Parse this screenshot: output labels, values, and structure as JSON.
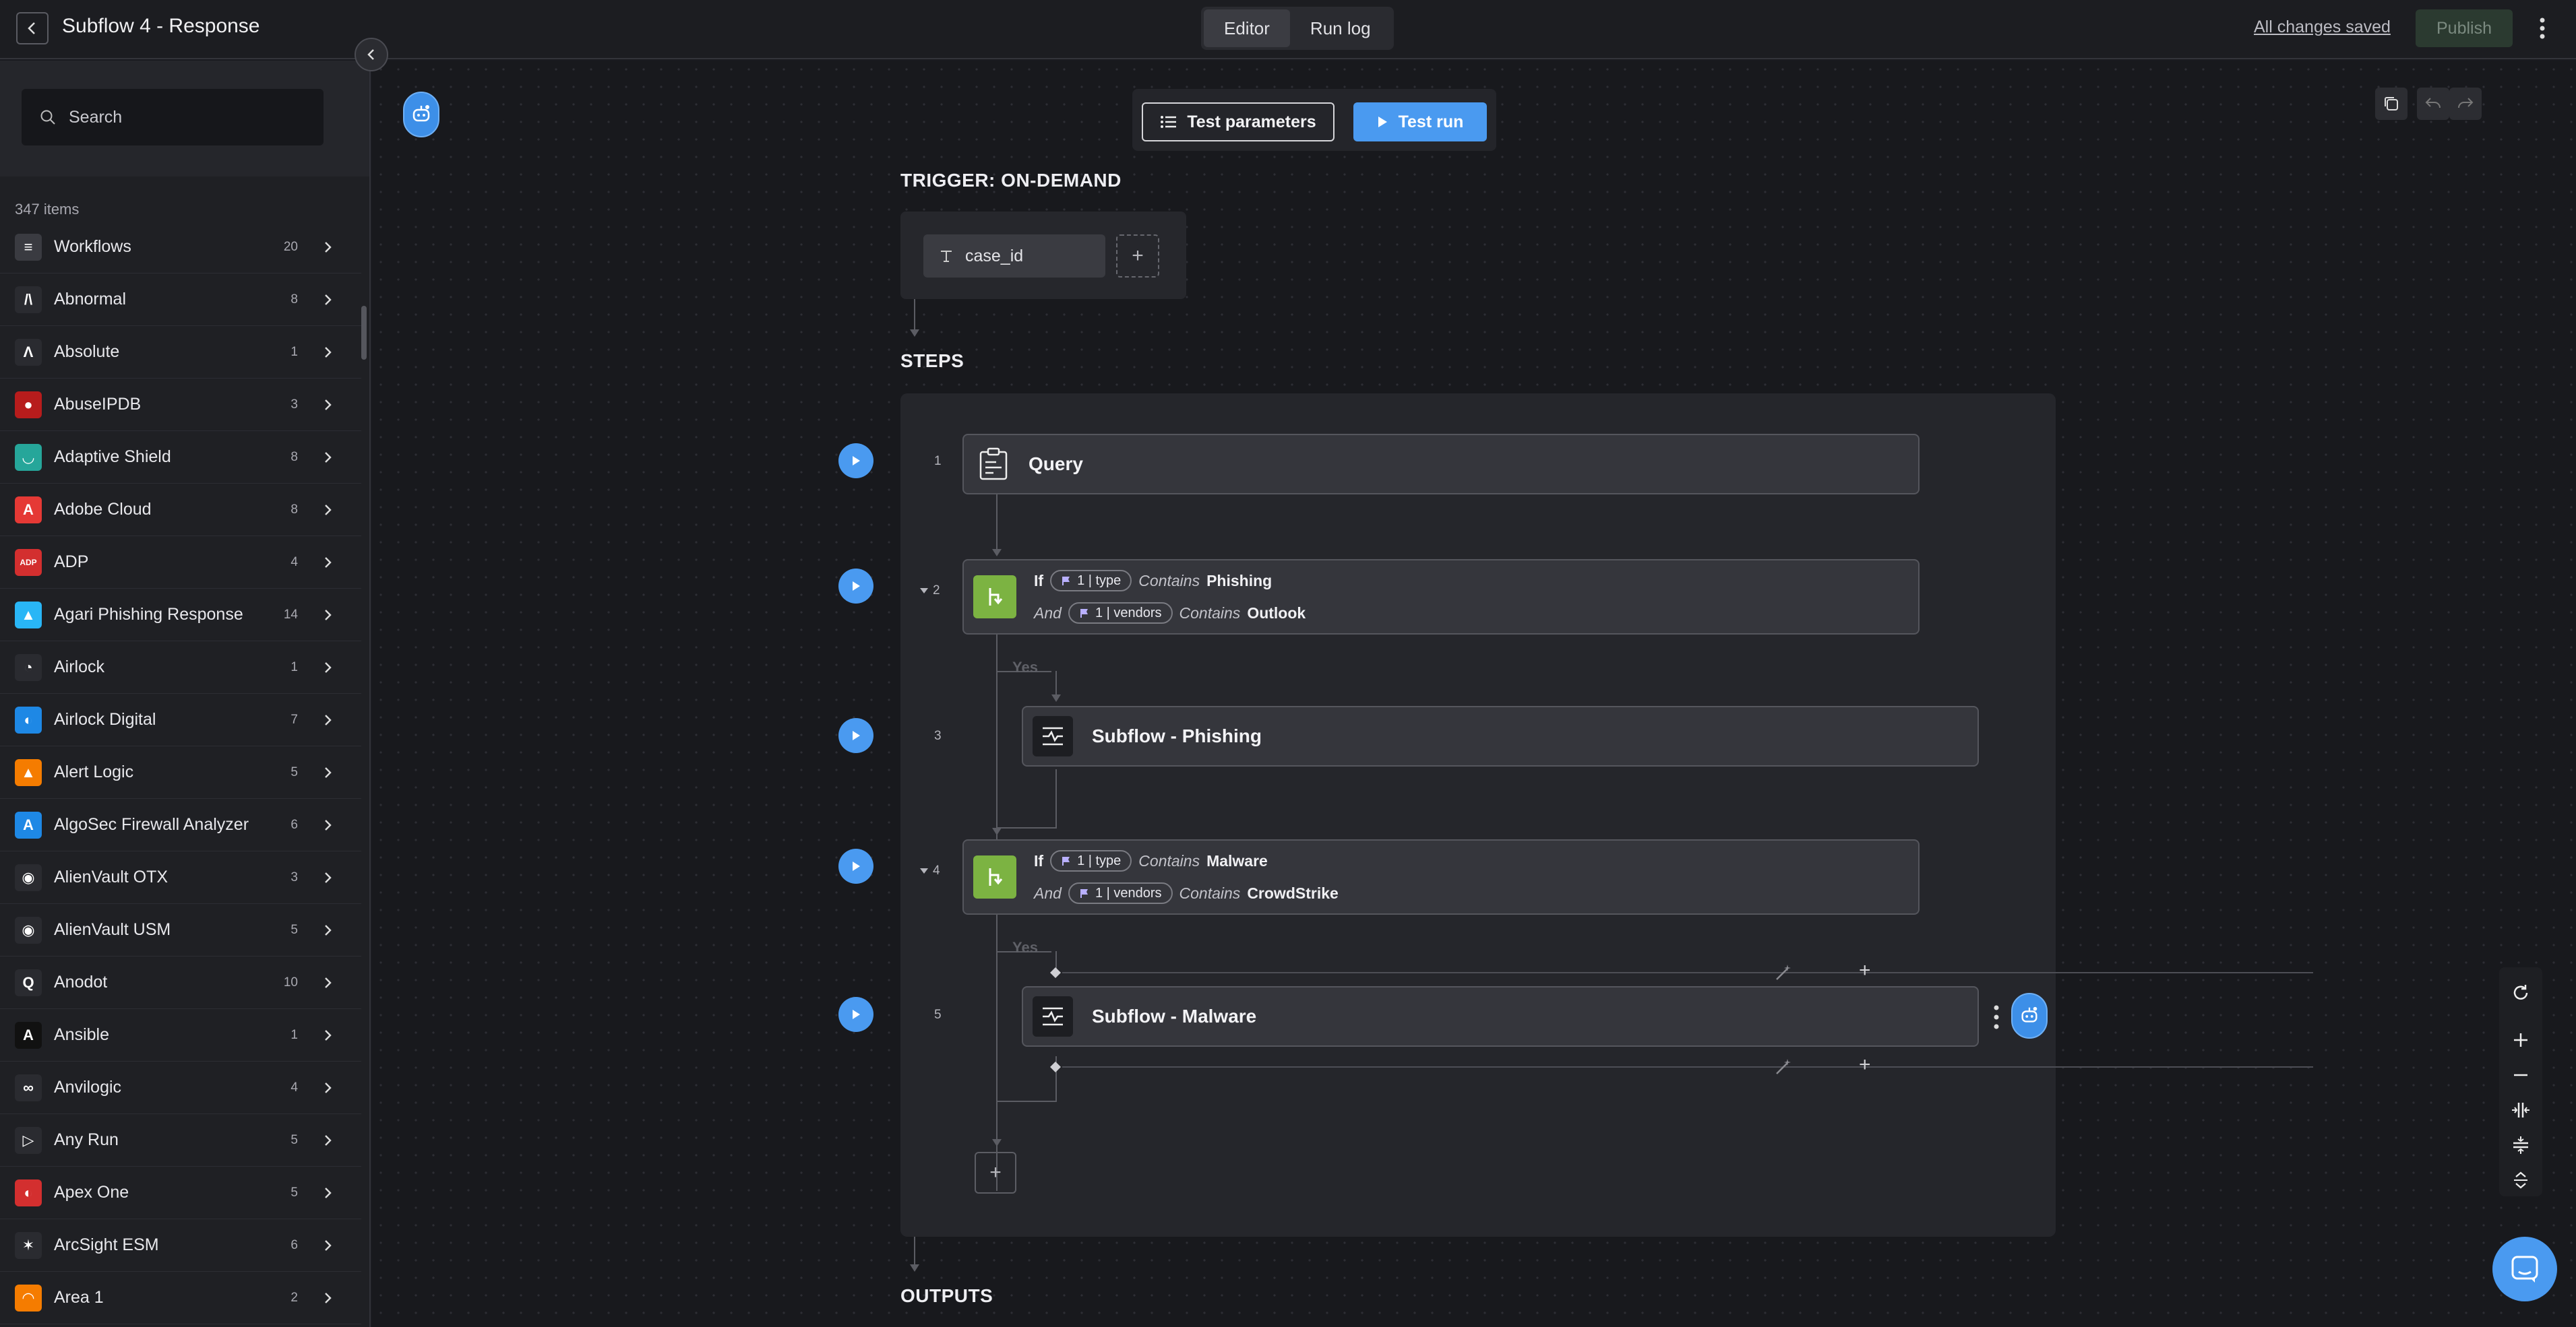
{
  "header": {
    "back_icon": "chevron-left-icon",
    "title": "Subflow 4 - Response",
    "tabs": [
      {
        "label": "Editor",
        "active": true
      },
      {
        "label": "Run log",
        "active": false
      }
    ],
    "saved_status": "All changes saved",
    "publish_label": "Publish"
  },
  "sidebar": {
    "search_placeholder": "Search",
    "item_count": "347 items",
    "items": [
      {
        "label": "Workflows",
        "count": "20",
        "icon": "workflow-icon",
        "color": "#3a3b41"
      },
      {
        "label": "Abnormal",
        "count": "8",
        "icon": "abnormal-logo-icon",
        "color": "#2a2b30"
      },
      {
        "label": "Absolute",
        "count": "1",
        "icon": "absolute-logo-icon",
        "color": "#2a2b30"
      },
      {
        "label": "AbuseIPDB",
        "count": "3",
        "icon": "abuseipdb-logo-icon",
        "color": "#b71c1c"
      },
      {
        "label": "Adaptive Shield",
        "count": "8",
        "icon": "adaptive-shield-logo-icon",
        "color": "#26a69a"
      },
      {
        "label": "Adobe Cloud",
        "count": "8",
        "icon": "adobe-cloud-logo-icon",
        "color": "#e53935"
      },
      {
        "label": "ADP",
        "count": "4",
        "icon": "adp-logo-icon",
        "color": "#d32f2f"
      },
      {
        "label": "Agari Phishing Response",
        "count": "14",
        "icon": "agari-logo-icon",
        "color": "#29b6f6"
      },
      {
        "label": "Airlock",
        "count": "1",
        "icon": "airlock-logo-icon",
        "color": "#2a2b30"
      },
      {
        "label": "Airlock Digital",
        "count": "7",
        "icon": "airlock-digital-logo-icon",
        "color": "#1e88e5"
      },
      {
        "label": "Alert Logic",
        "count": "5",
        "icon": "alert-logic-logo-icon",
        "color": "#f57c00"
      },
      {
        "label": "AlgoSec Firewall Analyzer",
        "count": "6",
        "icon": "algosec-logo-icon",
        "color": "#1e88e5"
      },
      {
        "label": "AlienVault OTX",
        "count": "3",
        "icon": "alienvault-otx-logo-icon",
        "color": "#2a2b30"
      },
      {
        "label": "AlienVault USM",
        "count": "5",
        "icon": "alienvault-usm-logo-icon",
        "color": "#2a2b30"
      },
      {
        "label": "Anodot",
        "count": "10",
        "icon": "anodot-logo-icon",
        "color": "#2a2b30"
      },
      {
        "label": "Ansible",
        "count": "1",
        "icon": "ansible-logo-icon",
        "color": "#111111"
      },
      {
        "label": "Anvilogic",
        "count": "4",
        "icon": "anvilogic-logo-icon",
        "color": "#2a2b30"
      },
      {
        "label": "Any Run",
        "count": "5",
        "icon": "any-run-logo-icon",
        "color": "#2a2b30"
      },
      {
        "label": "Apex One",
        "count": "5",
        "icon": "apex-one-logo-icon",
        "color": "#d32f2f"
      },
      {
        "label": "ArcSight ESM",
        "count": "6",
        "icon": "arcsight-logo-icon",
        "color": "#2a2b30"
      },
      {
        "label": "Area 1",
        "count": "2",
        "icon": "area1-logo-icon",
        "color": "#f57c00"
      }
    ]
  },
  "canvas": {
    "toolbar": {
      "test_params_label": "Test parameters",
      "test_run_label": "Test run"
    },
    "trigger": {
      "title": "TRIGGER: ON-DEMAND",
      "param_name": "case_id",
      "add_label": "+"
    },
    "steps_title": "STEPS",
    "outputs_title": "OUTPUTS",
    "steps": [
      {
        "num": "1",
        "title": "Query"
      },
      {
        "num": "2",
        "cond1_kw": "If",
        "cond1_var": "1 | type",
        "cond1_op": "Contains",
        "cond1_val": "Phishing",
        "cond2_kw": "And",
        "cond2_var": "1 | vendors",
        "cond2_op": "Contains",
        "cond2_val": "Outlook"
      },
      {
        "num": "3",
        "title": "Subflow - Phishing"
      },
      {
        "num": "4",
        "cond1_kw": "If",
        "cond1_var": "1 | type",
        "cond1_op": "Contains",
        "cond1_val": "Malware",
        "cond2_kw": "And",
        "cond2_var": "1 | vendors",
        "cond2_op": "Contains",
        "cond2_val": "CrowdStrike"
      },
      {
        "num": "5",
        "title": "Subflow - Malware"
      }
    ],
    "yes_label": "Yes",
    "add_step_label": "+",
    "insert_label": "+"
  },
  "colors": {
    "accent": "#4a9af0",
    "condition": "#7cb342",
    "background": "#18191d"
  }
}
